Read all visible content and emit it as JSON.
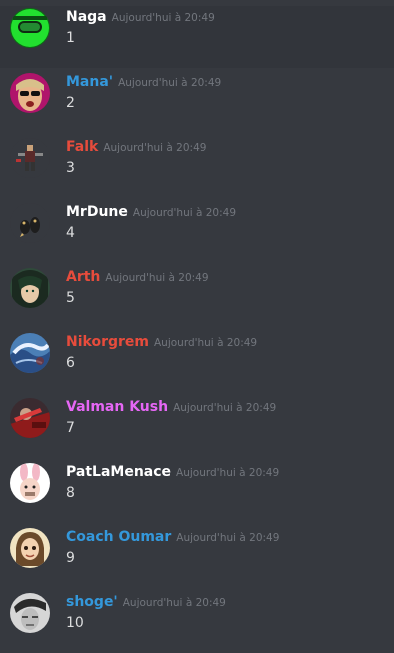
{
  "timestamp_text": "Aujourd'hui à 20:49",
  "colors": {
    "background": "#36393f",
    "hover_background": "#32353b",
    "timestamp": "#72767d",
    "message_text": "#dcddde"
  },
  "messages": [
    {
      "username": "Naga",
      "name_color": "#ffffff",
      "content": "1",
      "avatar_icon": "green-visor-avatar-icon"
    },
    {
      "username": "Mana'",
      "name_color": "#3498db",
      "content": "2",
      "avatar_icon": "sunglasses-face-avatar-icon"
    },
    {
      "username": "Falk",
      "name_color": "#e74c3c",
      "content": "3",
      "avatar_icon": "pixel-character-avatar-icon"
    },
    {
      "username": "MrDune",
      "name_color": "#ffffff",
      "content": "4",
      "avatar_icon": "bird-avatar-icon"
    },
    {
      "username": "Arth",
      "name_color": "#e74c3c",
      "content": "5",
      "avatar_icon": "anime-face-avatar-icon"
    },
    {
      "username": "Nikorgrem",
      "name_color": "#e74c3c",
      "content": "6",
      "avatar_icon": "blue-wave-avatar-icon"
    },
    {
      "username": "Valman Kush",
      "name_color": "#e667f5",
      "content": "7",
      "avatar_icon": "red-figure-avatar-icon"
    },
    {
      "username": "PatLaMenace",
      "name_color": "#ffffff",
      "content": "8",
      "avatar_icon": "bunny-avatar-icon"
    },
    {
      "username": "Coach Oumar",
      "name_color": "#3498db",
      "content": "9",
      "avatar_icon": "cartoon-woman-avatar-icon"
    },
    {
      "username": "shoge'",
      "name_color": "#3498db",
      "content": "10",
      "avatar_icon": "sketch-face-avatar-icon"
    }
  ]
}
